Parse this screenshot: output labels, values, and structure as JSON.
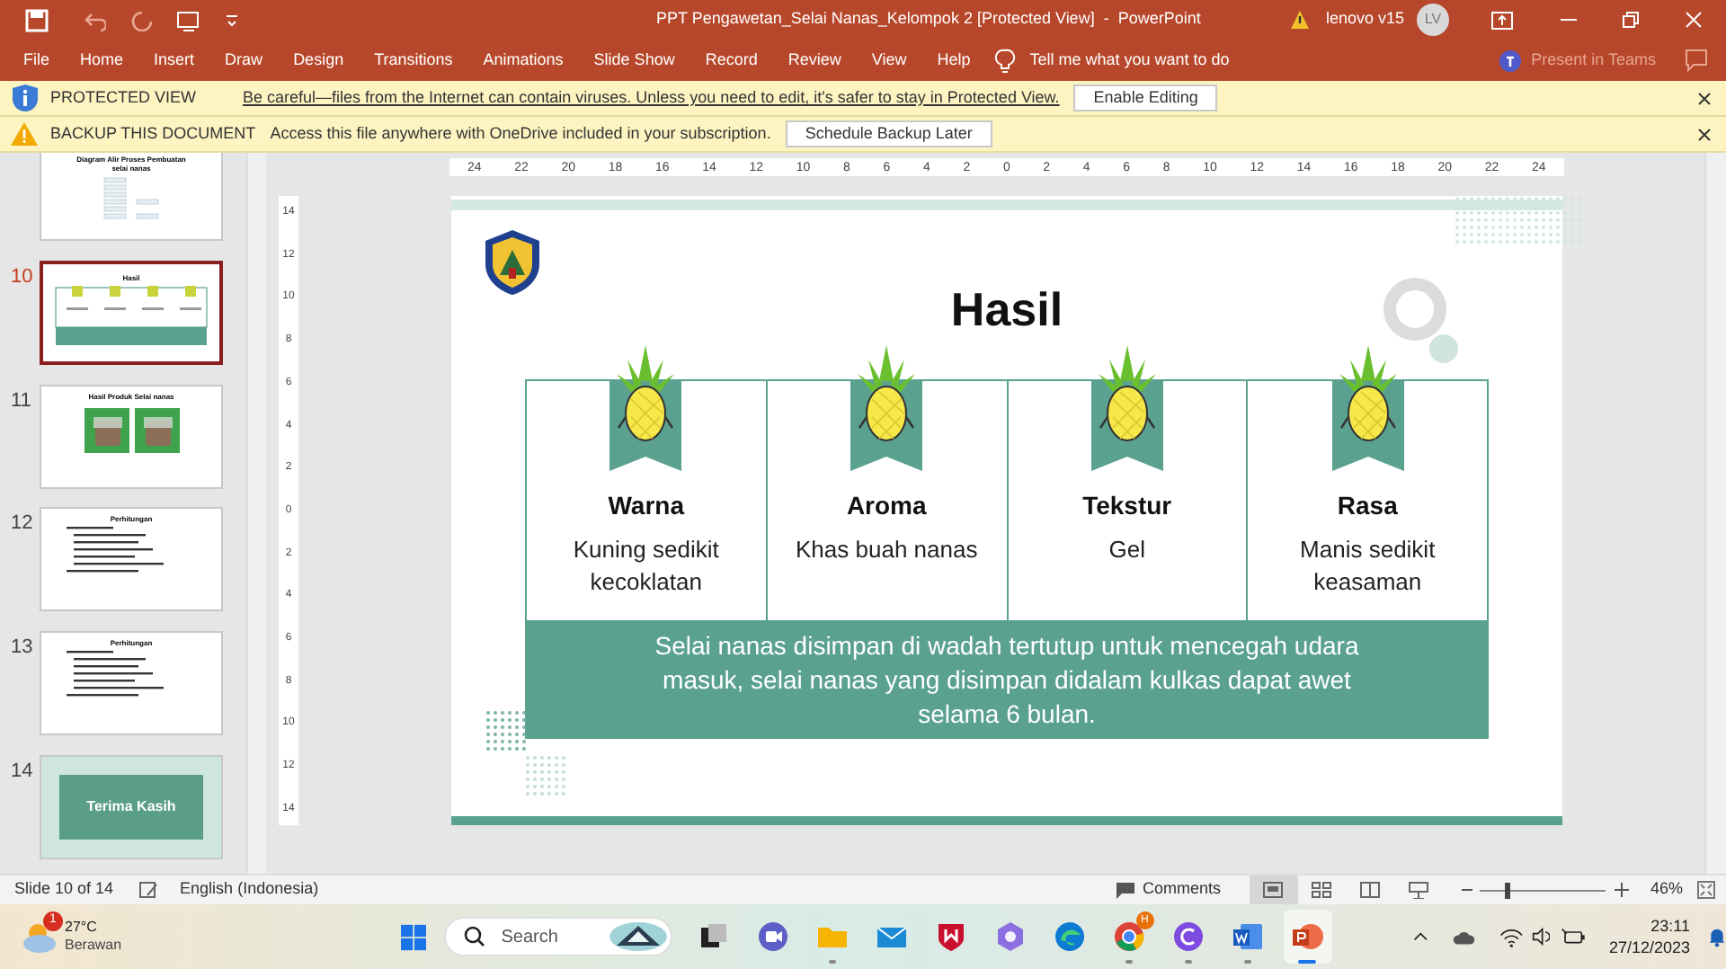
{
  "title_bar": {
    "title": "PPT Pengawetan_Selai Nanas_Kelompok 2 [Protected View]  -  PowerPoint",
    "user": "lenovo v15",
    "avatar": "LV"
  },
  "ribbon": {
    "tabs": [
      "File",
      "Home",
      "Insert",
      "Draw",
      "Design",
      "Transitions",
      "Animations",
      "Slide Show",
      "Record",
      "Review",
      "View",
      "Help"
    ],
    "tell_me": "Tell me what you want to do",
    "present": "Present in Teams"
  },
  "notices": [
    {
      "kind": "protected",
      "title": "PROTECTED VIEW",
      "message": "Be careful—files from the Internet can contain viruses. Unless you need to edit, it's safer to stay in Protected View.",
      "button": "Enable Editing"
    },
    {
      "kind": "backup",
      "title": "BACKUP THIS DOCUMENT",
      "message": "Access this file anywhere with OneDrive included in your subscription.",
      "button": "Schedule Backup Later"
    }
  ],
  "thumbnails": [
    {
      "kind": "diagram",
      "title": "Diagram Alir Proses Pembuatan selai nanas",
      "selected": false
    },
    {
      "kind": "result",
      "number": "10",
      "title": "Hasil",
      "selected": true
    },
    {
      "kind": "photos",
      "number": "11",
      "title": "Hasil Produk Selai nanas",
      "selected": false
    },
    {
      "kind": "list",
      "number": "12",
      "title": "Perhitungan",
      "selected": false
    },
    {
      "kind": "list",
      "number": "13",
      "title": "Perhitungan",
      "selected": false
    },
    {
      "kind": "closing",
      "number": "14",
      "title": "Terima Kasih",
      "selected": false
    }
  ],
  "ruler": {
    "horizontal": [
      "24",
      "22",
      "20",
      "18",
      "16",
      "14",
      "12",
      "10",
      "8",
      "6",
      "4",
      "2",
      "0",
      "2",
      "4",
      "6",
      "8",
      "10",
      "12",
      "14",
      "16",
      "18",
      "20",
      "22",
      "24"
    ],
    "vertical": [
      "14",
      "12",
      "10",
      "8",
      "6",
      "4",
      "2",
      "0",
      "2",
      "4",
      "6",
      "8",
      "10",
      "12",
      "14"
    ]
  },
  "slide": {
    "title": "Hasil",
    "columns": [
      {
        "heading": "Warna",
        "text": "Kuning sedikit kecoklatan"
      },
      {
        "heading": "Aroma",
        "text": "Khas buah nanas"
      },
      {
        "heading": "Tekstur",
        "text": "Gel"
      },
      {
        "heading": "Rasa",
        "text": "Manis sedikit keasaman"
      }
    ],
    "summary": "Selai nanas disimpan di wadah tertutup untuk mencegah udara masuk, selai nanas yang disimpan didalam kulkas dapat awet selama 6 bulan."
  },
  "status_bar": {
    "slide": "Slide 10 of 14",
    "language": "English (Indonesia)",
    "comments": "Comments",
    "views": [
      {
        "kind": "normal",
        "selected": true
      },
      {
        "kind": "sorter",
        "selected": false
      },
      {
        "kind": "reading",
        "selected": false
      },
      {
        "kind": "show",
        "selected": false
      }
    ],
    "zoom": {
      "level": 0.21,
      "reading": "46%"
    }
  },
  "taskbar": {
    "weather": {
      "temp": "27°C",
      "condition": "Berawan",
      "badge": "1"
    },
    "search": "Search",
    "apps": [
      {
        "kind": "taskview",
        "running": false,
        "selected": false
      },
      {
        "kind": "meet",
        "running": false,
        "selected": false
      },
      {
        "kind": "files",
        "running": true,
        "selected": false
      },
      {
        "kind": "mail",
        "running": false,
        "selected": false
      },
      {
        "kind": "shield",
        "running": false,
        "selected": false
      },
      {
        "kind": "copilot",
        "running": false,
        "selected": false
      },
      {
        "kind": "edge",
        "running": false,
        "selected": false
      },
      {
        "kind": "chrome",
        "running": true,
        "selected": false,
        "badge": "H"
      },
      {
        "kind": "canva",
        "running": true,
        "selected": false
      },
      {
        "kind": "word",
        "running": true,
        "selected": false
      },
      {
        "kind": "powerpoint",
        "running": true,
        "selected": true
      }
    ],
    "time": "23:11",
    "date": "27/12/2023"
  }
}
